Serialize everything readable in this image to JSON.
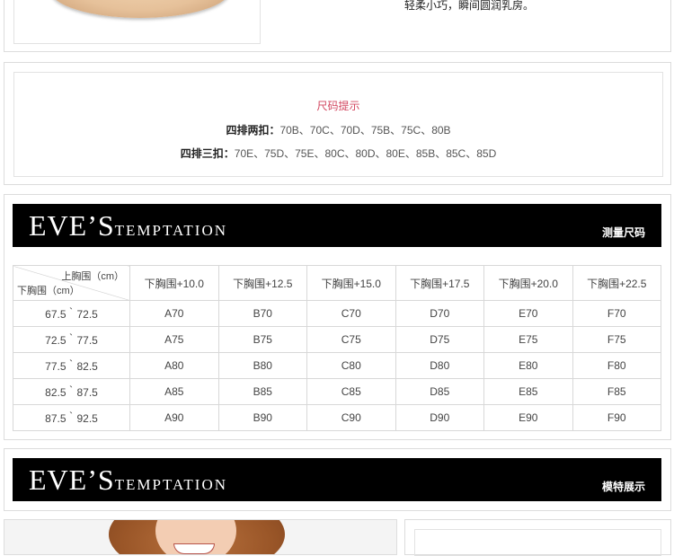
{
  "product": {
    "description": "轻柔小巧，瞬间圆润乳房。"
  },
  "size_tips": {
    "title": "尺码提示",
    "rows": [
      {
        "label": "四排两扣：",
        "sizes": "70B、70C、70D、75B、75C、80B"
      },
      {
        "label": "四排三扣：",
        "sizes": "70E、75D、75E、80C、80D、80E、85B、85C、85D"
      }
    ]
  },
  "banners": [
    {
      "brand_big_1": "EVE",
      "brand_apostrophe": "’",
      "brand_big_2": "S",
      "brand_small": "TEMPTATION",
      "tag": "测量尺码"
    },
    {
      "brand_big_1": "EVE",
      "brand_apostrophe": "’",
      "brand_big_2": "S",
      "brand_small": "TEMPTATION",
      "tag": "模特展示"
    }
  ],
  "size_table": {
    "corner_top": "上胸围（cm）",
    "corner_bottom": "下胸围（cm）",
    "columns": [
      "下胸围+10.0",
      "下胸围+12.5",
      "下胸围+15.0",
      "下胸围+17.5",
      "下胸围+20.0",
      "下胸围+22.5"
    ],
    "rows": [
      {
        "range": "67.5｀72.5",
        "cells": [
          "A70",
          "B70",
          "C70",
          "D70",
          "E70",
          "F70"
        ]
      },
      {
        "range": "72.5｀77.5",
        "cells": [
          "A75",
          "B75",
          "C75",
          "D75",
          "E75",
          "F75"
        ]
      },
      {
        "range": "77.5｀82.5",
        "cells": [
          "A80",
          "B80",
          "C80",
          "D80",
          "E80",
          "F80"
        ]
      },
      {
        "range": "82.5｀87.5",
        "cells": [
          "A85",
          "B85",
          "C85",
          "D85",
          "E85",
          "F85"
        ]
      },
      {
        "range": "87.5｀92.5",
        "cells": [
          "A90",
          "B90",
          "C90",
          "D90",
          "E90",
          "F90"
        ]
      }
    ]
  },
  "colors": {
    "accent": "#d2465f",
    "banner_bg": "#000000",
    "border": "#dcdcdc"
  }
}
